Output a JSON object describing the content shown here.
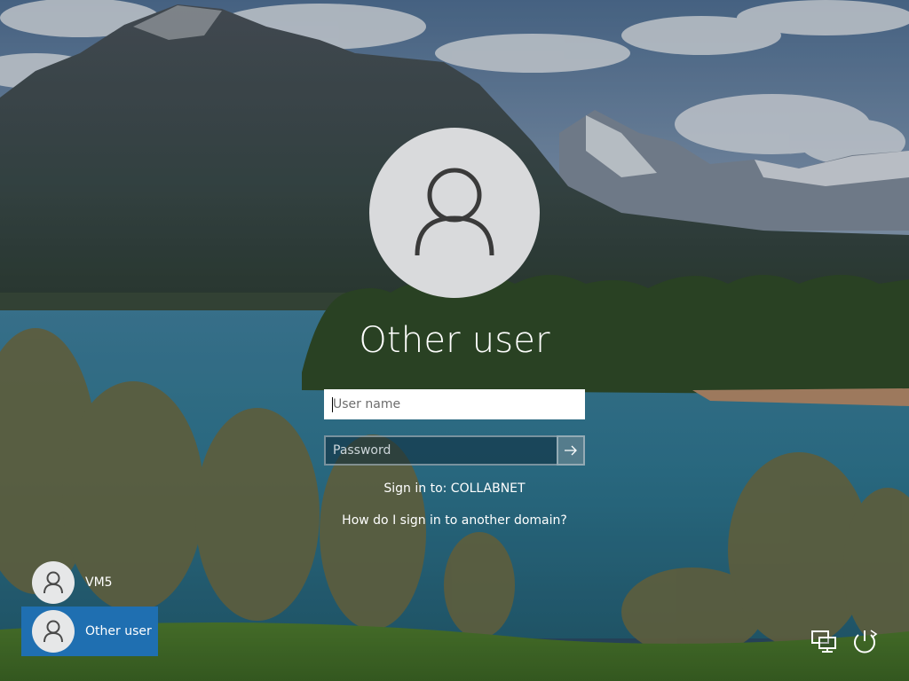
{
  "login": {
    "username": "Other user",
    "username_placeholder": "User name",
    "password_placeholder": "Password",
    "signin_to": "Sign in to: COLLABNET",
    "domain_help_link": "How do I sign in to another domain?"
  },
  "user_switcher": {
    "users": [
      {
        "label": "VM5",
        "selected": false
      },
      {
        "label": "Other user",
        "selected": true
      }
    ]
  },
  "system_buttons": {
    "network": "network-icon",
    "accessibility": "ease-of-access-icon",
    "power": "power-icon"
  },
  "colors": {
    "selected_tile": "#1f6fb1",
    "avatar_bg": "#d9dadc",
    "text": "#ffffff"
  }
}
